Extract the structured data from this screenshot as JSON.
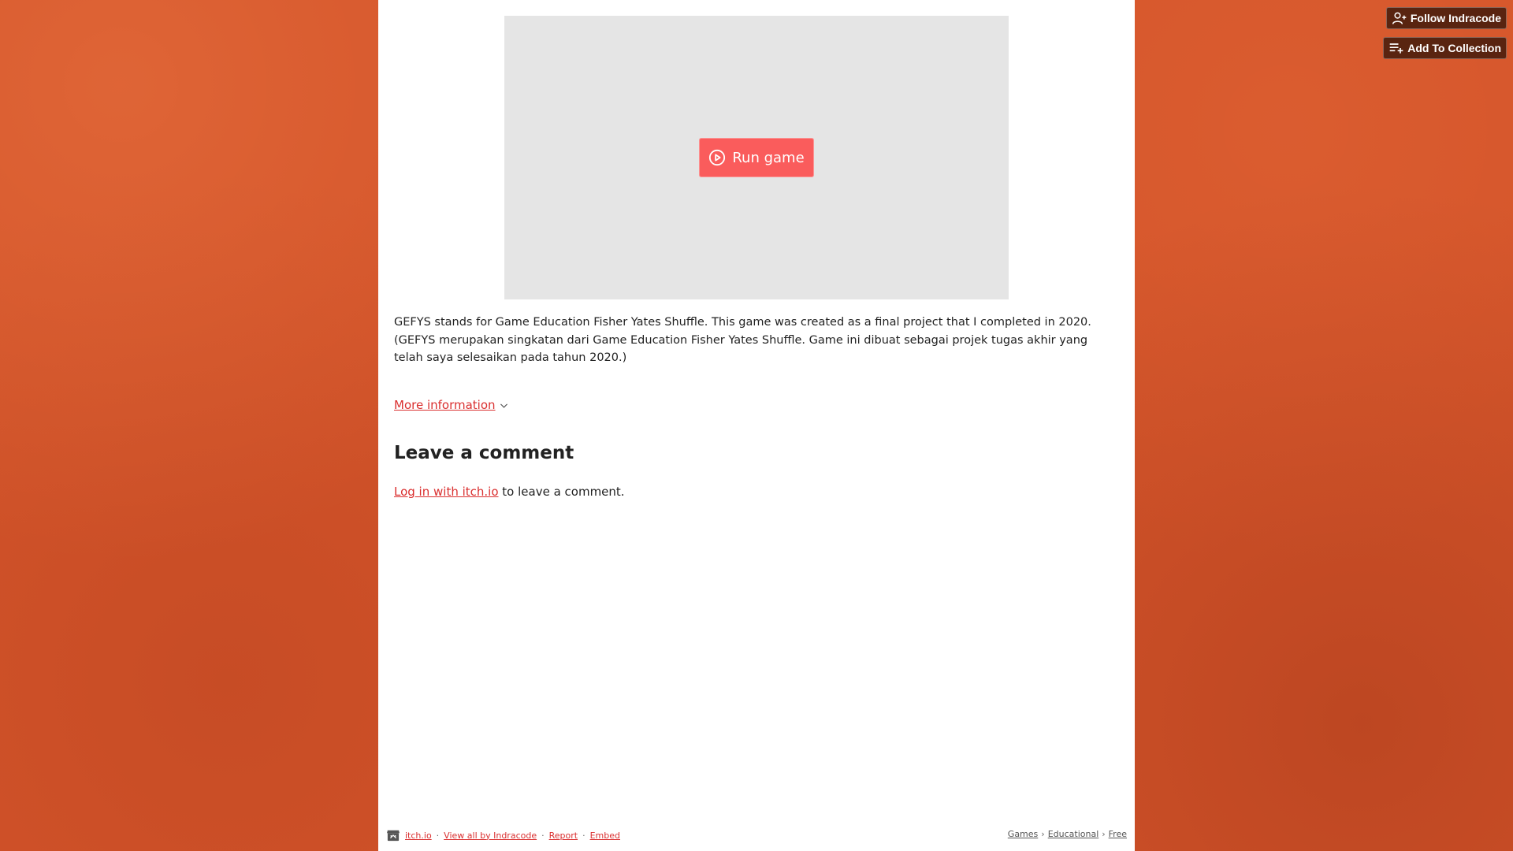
{
  "top_buttons": {
    "follow_label": "Follow Indracode",
    "collection_label": "Add To Collection"
  },
  "game": {
    "run_label": "Run game",
    "description": "GEFYS stands for Game Education Fisher Yates Shuffle. This game was created as a final project that I completed in 2020. (GEFYS merupakan singkatan dari Game Education Fisher Yates Shuffle.  Game ini dibuat sebagai projek tugas akhir yang telah saya selesaikan pada tahun 2020.)",
    "more_info_label": "More information"
  },
  "comments": {
    "title": "Leave a comment",
    "login_link": "Log in with itch.io",
    "login_suffix": " to leave a comment."
  },
  "footer": {
    "left_links": [
      "itch.io",
      "View all by Indracode",
      "Report",
      "Embed"
    ],
    "separator": "·",
    "breadcrumb": [
      "Games",
      "Educational",
      "Free"
    ],
    "breadcrumb_separator": "›"
  },
  "colors": {
    "background": "#d4542a",
    "accent": "#fa5c5c",
    "link": "#da2f2f"
  }
}
